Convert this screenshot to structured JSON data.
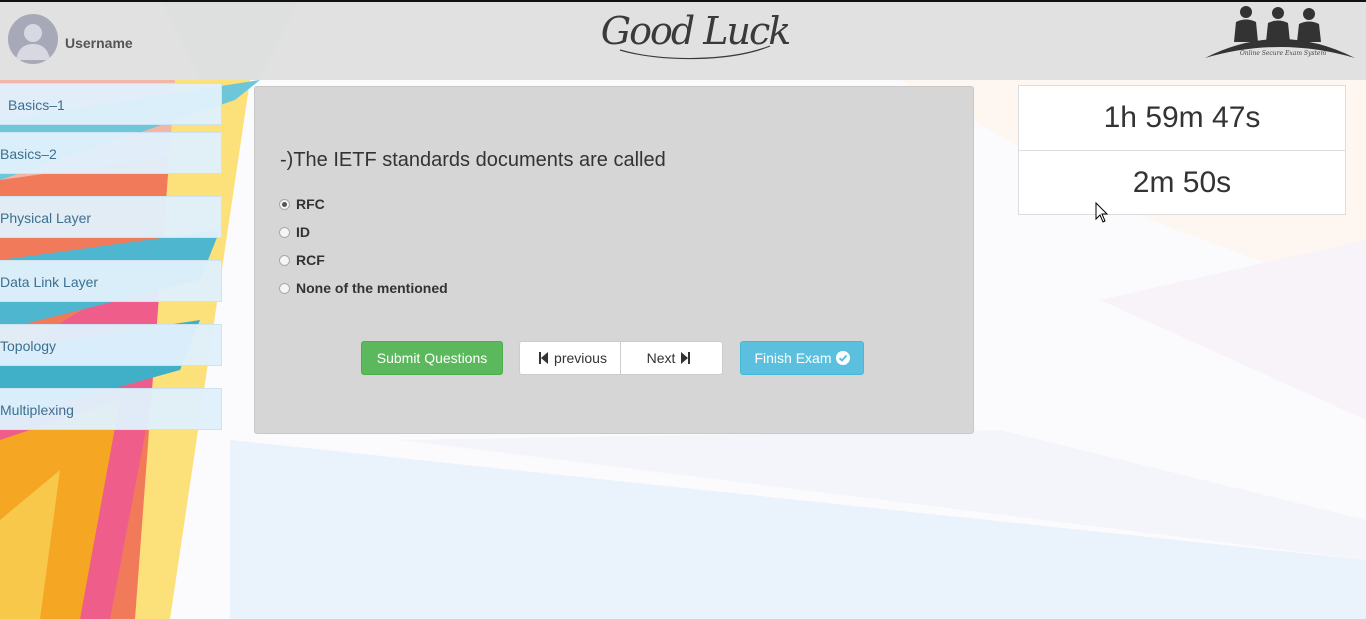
{
  "header": {
    "username": "Username",
    "logo_text": "Good Luck",
    "brand_caption": "Online Secure Exam System"
  },
  "sidebar": {
    "items": [
      {
        "label": "Basics–1"
      },
      {
        "label": "Basics–2"
      },
      {
        "label": "Physical Layer"
      },
      {
        "label": "Data Link Layer"
      },
      {
        "label": "Topology"
      },
      {
        "label": "Multiplexing"
      }
    ]
  },
  "question": {
    "text": "-)The IETF standards documents are called",
    "options": [
      {
        "label": "RFC",
        "selected": true
      },
      {
        "label": "ID",
        "selected": false
      },
      {
        "label": "RCF",
        "selected": false
      },
      {
        "label": "None of the mentioned",
        "selected": false
      }
    ]
  },
  "buttons": {
    "submit": "Submit Questions",
    "previous": "previous",
    "next": "Next",
    "finish": "Finish Exam"
  },
  "timers": {
    "total_remaining": "1h 59m 47s",
    "question_remaining": "2m 50s"
  },
  "colors": {
    "submit": "#5cb85c",
    "finish": "#5bc0de",
    "sidebar_item": "#e0f0fc",
    "panel": "#d4d4d4"
  },
  "icons": [
    "user-avatar-icon",
    "step-backward-icon",
    "step-forward-icon",
    "check-circle-icon",
    "mouse-cursor-icon"
  ]
}
